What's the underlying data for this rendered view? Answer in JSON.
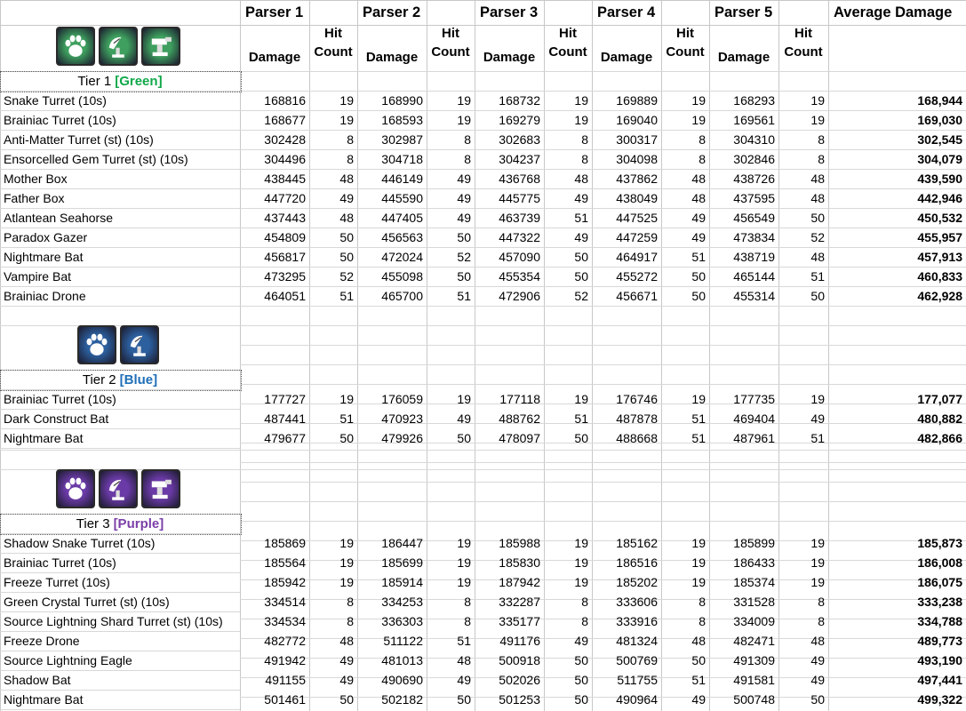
{
  "header": {
    "parsers": [
      "Parser 1",
      "Parser 2",
      "Parser 3",
      "Parser 4",
      "Parser 5"
    ],
    "average_label": "Average Damage",
    "damage_label": "Damage",
    "hit_label_1": "Hit",
    "hit_label_2": "Count"
  },
  "tiers": [
    {
      "title": "Tier 1",
      "color_label": "[Green]",
      "color": "#11a84a",
      "icons": [
        "paw-icon",
        "satellite-turret-icon",
        "cannon-turret-icon"
      ],
      "icon_bg": "#3e9f5e",
      "rows": [
        {
          "name": "Snake Turret (10s)",
          "p": [
            [
              168816,
              19
            ],
            [
              168990,
              19
            ],
            [
              168732,
              19
            ],
            [
              169889,
              19
            ],
            [
              168293,
              19
            ]
          ],
          "avg": "168,944"
        },
        {
          "name": "Brainiac Turret (10s)",
          "p": [
            [
              168677,
              19
            ],
            [
              168593,
              19
            ],
            [
              169279,
              19
            ],
            [
              169040,
              19
            ],
            [
              169561,
              19
            ]
          ],
          "avg": "169,030"
        },
        {
          "name": "Anti-Matter Turret (st) (10s)",
          "p": [
            [
              302428,
              8
            ],
            [
              302987,
              8
            ],
            [
              302683,
              8
            ],
            [
              300317,
              8
            ],
            [
              304310,
              8
            ]
          ],
          "avg": "302,545"
        },
        {
          "name": "Ensorcelled Gem Turret (st) (10s)",
          "p": [
            [
              304496,
              8
            ],
            [
              304718,
              8
            ],
            [
              304237,
              8
            ],
            [
              304098,
              8
            ],
            [
              302846,
              8
            ]
          ],
          "avg": "304,079"
        },
        {
          "name": "Mother Box",
          "p": [
            [
              438445,
              48
            ],
            [
              446149,
              49
            ],
            [
              436768,
              48
            ],
            [
              437862,
              48
            ],
            [
              438726,
              48
            ]
          ],
          "avg": "439,590"
        },
        {
          "name": "Father Box",
          "p": [
            [
              447720,
              49
            ],
            [
              445590,
              49
            ],
            [
              445775,
              49
            ],
            [
              438049,
              48
            ],
            [
              437595,
              48
            ]
          ],
          "avg": "442,946"
        },
        {
          "name": "Atlantean Seahorse",
          "p": [
            [
              437443,
              48
            ],
            [
              447405,
              49
            ],
            [
              463739,
              51
            ],
            [
              447525,
              49
            ],
            [
              456549,
              50
            ]
          ],
          "avg": "450,532"
        },
        {
          "name": "Paradox Gazer",
          "p": [
            [
              454809,
              50
            ],
            [
              456563,
              50
            ],
            [
              447322,
              49
            ],
            [
              447259,
              49
            ],
            [
              473834,
              52
            ]
          ],
          "avg": "455,957"
        },
        {
          "name": "Nightmare Bat",
          "p": [
            [
              456817,
              50
            ],
            [
              472024,
              52
            ],
            [
              457090,
              50
            ],
            [
              464917,
              51
            ],
            [
              438719,
              48
            ]
          ],
          "avg": "457,913"
        },
        {
          "name": "Vampire Bat",
          "p": [
            [
              473295,
              52
            ],
            [
              455098,
              50
            ],
            [
              455354,
              50
            ],
            [
              455272,
              50
            ],
            [
              465144,
              51
            ]
          ],
          "avg": "460,833"
        },
        {
          "name": "Brainiac Drone",
          "p": [
            [
              464051,
              51
            ],
            [
              465700,
              51
            ],
            [
              472906,
              52
            ],
            [
              456671,
              50
            ],
            [
              455314,
              50
            ]
          ],
          "avg": "462,928"
        }
      ]
    },
    {
      "title": "Tier 2",
      "color_label": "[Blue]",
      "color": "#1f6fb8",
      "icons": [
        "paw-icon",
        "satellite-turret-icon"
      ],
      "icon_bg": "#2c5f9e",
      "rows": [
        {
          "name": "Brainiac Turret (10s)",
          "p": [
            [
              177727,
              19
            ],
            [
              176059,
              19
            ],
            [
              177118,
              19
            ],
            [
              176746,
              19
            ],
            [
              177735,
              19
            ]
          ],
          "avg": "177,077"
        },
        {
          "name": "Dark Construct Bat",
          "p": [
            [
              487441,
              51
            ],
            [
              470923,
              49
            ],
            [
              488762,
              51
            ],
            [
              487878,
              51
            ],
            [
              469404,
              49
            ]
          ],
          "avg": "480,882"
        },
        {
          "name": "Nightmare Bat",
          "p": [
            [
              479677,
              50
            ],
            [
              479926,
              50
            ],
            [
              478097,
              50
            ],
            [
              488668,
              51
            ],
            [
              487961,
              51
            ]
          ],
          "avg": "482,866"
        }
      ]
    },
    {
      "title": "Tier 3",
      "color_label": "[Purple]",
      "color": "#7a3fa8",
      "icons": [
        "paw-icon",
        "satellite-turret-icon",
        "cannon-turret-icon"
      ],
      "icon_bg": "#6a3aa6",
      "rows": [
        {
          "name": "Shadow Snake Turret (10s)",
          "p": [
            [
              185869,
              19
            ],
            [
              186447,
              19
            ],
            [
              185988,
              19
            ],
            [
              185162,
              19
            ],
            [
              185899,
              19
            ]
          ],
          "avg": "185,873"
        },
        {
          "name": "Brainiac Turret (10s)",
          "p": [
            [
              185564,
              19
            ],
            [
              185699,
              19
            ],
            [
              185830,
              19
            ],
            [
              186516,
              19
            ],
            [
              186433,
              19
            ]
          ],
          "avg": "186,008"
        },
        {
          "name": "Freeze Turret (10s)",
          "p": [
            [
              185942,
              19
            ],
            [
              185914,
              19
            ],
            [
              187942,
              19
            ],
            [
              185202,
              19
            ],
            [
              185374,
              19
            ]
          ],
          "avg": "186,075"
        },
        {
          "name": "Green Crystal Turret (st) (10s)",
          "p": [
            [
              334514,
              8
            ],
            [
              334253,
              8
            ],
            [
              332287,
              8
            ],
            [
              333606,
              8
            ],
            [
              331528,
              8
            ]
          ],
          "avg": "333,238"
        },
        {
          "name": "Source Lightning Shard Turret (st) (10s)",
          "p": [
            [
              334534,
              8
            ],
            [
              336303,
              8
            ],
            [
              335177,
              8
            ],
            [
              333916,
              8
            ],
            [
              334009,
              8
            ]
          ],
          "avg": "334,788"
        },
        {
          "name": "Freeze Drone",
          "p": [
            [
              482772,
              48
            ],
            [
              511122,
              51
            ],
            [
              491176,
              49
            ],
            [
              481324,
              48
            ],
            [
              482471,
              48
            ]
          ],
          "avg": "489,773"
        },
        {
          "name": "Source Lightning Eagle",
          "p": [
            [
              491942,
              49
            ],
            [
              481013,
              48
            ],
            [
              500918,
              50
            ],
            [
              500769,
              50
            ],
            [
              491309,
              49
            ]
          ],
          "avg": "493,190"
        },
        {
          "name": "Shadow Bat",
          "p": [
            [
              491155,
              49
            ],
            [
              490690,
              49
            ],
            [
              502026,
              50
            ],
            [
              511755,
              51
            ],
            [
              491581,
              49
            ]
          ],
          "avg": "497,441"
        },
        {
          "name": "Nightmare Bat",
          "p": [
            [
              501461,
              50
            ],
            [
              502182,
              50
            ],
            [
              501253,
              50
            ],
            [
              490964,
              49
            ],
            [
              500748,
              50
            ]
          ],
          "avg": "499,322"
        }
      ]
    }
  ]
}
